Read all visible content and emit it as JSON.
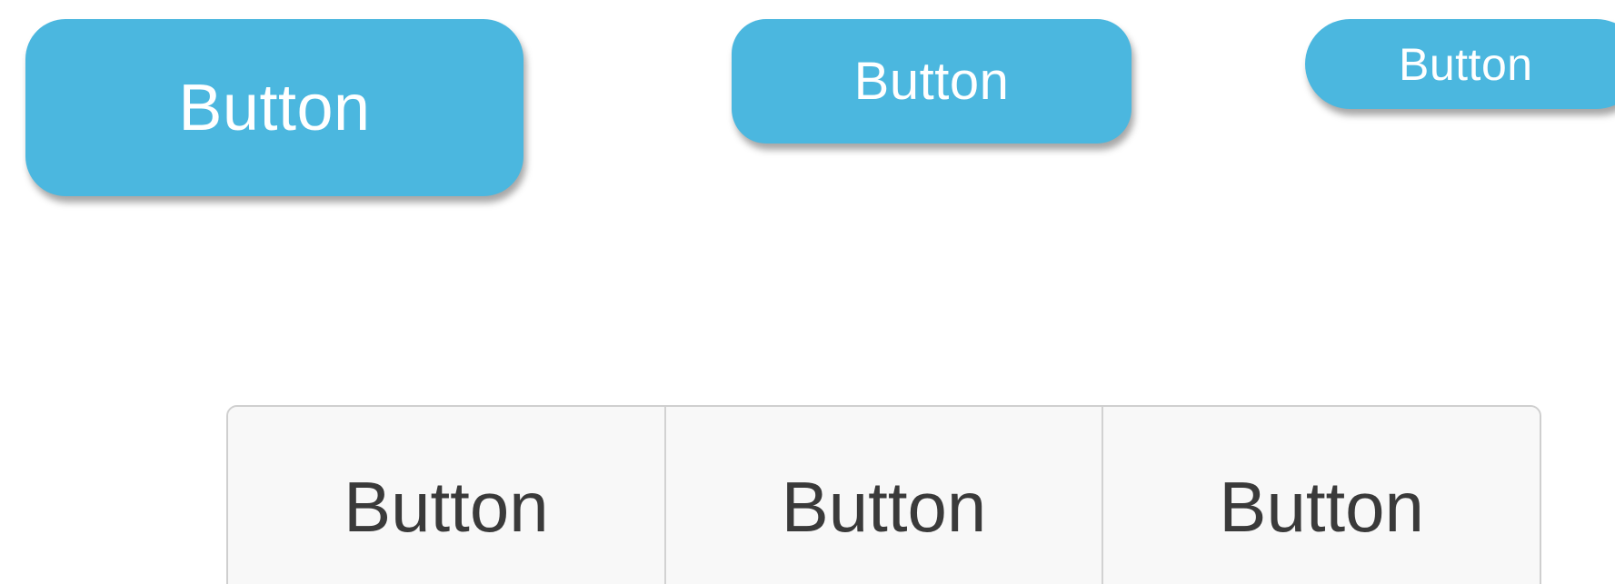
{
  "colors": {
    "primary_button": "#4bb7df",
    "primary_text": "#ffffff",
    "segment_bg": "#f8f8f8",
    "segment_text": "#3a3a3a",
    "segment_border": "#cfcfcf"
  },
  "raised_buttons": {
    "large_label": "Button",
    "medium_label": "Button",
    "small_label": "Button"
  },
  "segmented_control": {
    "segments": [
      {
        "label": "Button"
      },
      {
        "label": "Button"
      },
      {
        "label": "Button"
      }
    ]
  }
}
